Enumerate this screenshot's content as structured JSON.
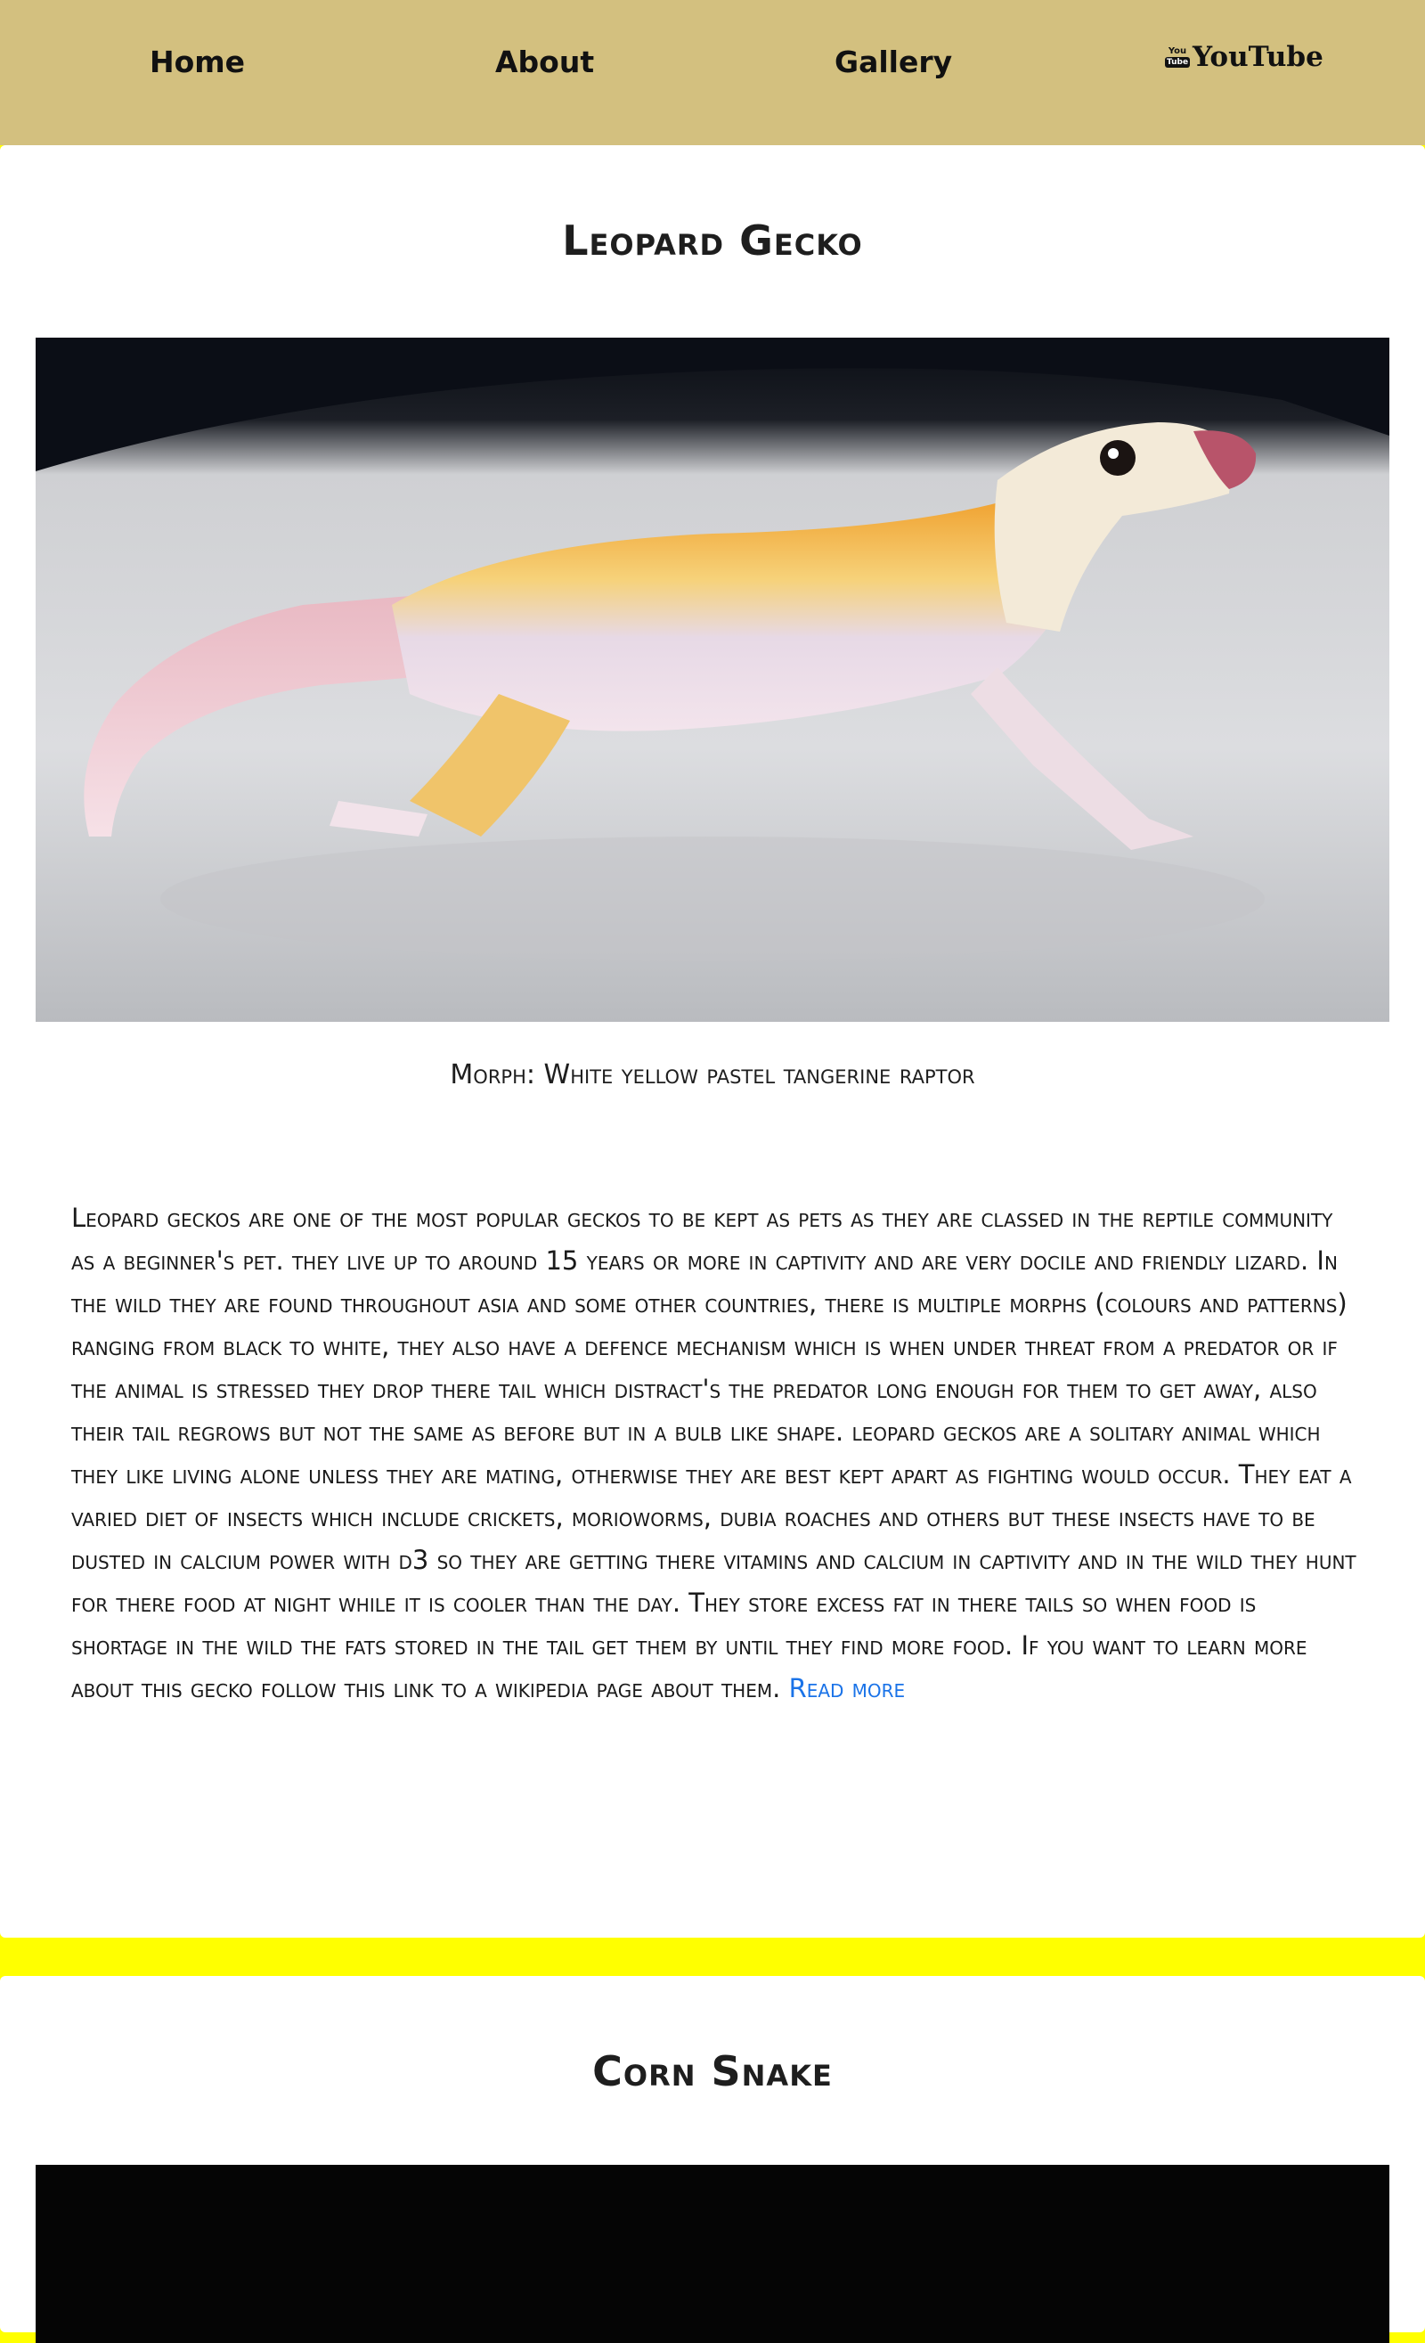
{
  "nav": {
    "home": "Home",
    "about": "About",
    "gallery": "Gallery",
    "youtube": "YouTube",
    "youtube_icon_you": "You",
    "youtube_icon_tube": "Tube"
  },
  "sections": [
    {
      "title": "Leopard Gecko",
      "caption": "Morph: White yellow pastel tangerine raptor",
      "description": "Leopard geckos are one of the most popular geckos to be kept as pets as they are classed in the reptile community as a beginner's pet. they live up to around 15 years or more in captivity and are very docile and friendly lizard. In the wild they are found throughout asia and some other countries, there is multiple morphs (colours and patterns) ranging from black to white, they also have a defence mechanism which is when under threat from a predator or if the animal is stressed they drop there tail which distract's the predator long enough for them to get away, also their tail regrows but not the same as before but in a bulb like shape. leopard geckos are a solitary animal which they like living alone unless they are mating, otherwise they are best kept apart as fighting would occur. They eat a varied diet of insects which include crickets, morioworms, dubia roaches and others but these insects have to be dusted in calcium power with d3 so they are getting there vitamins and calcium in captivity and in the wild they hunt for there food at night while it is cooler than the day. They store excess fat in there tails so when food is shortage in the wild the fats stored in the tail get them by until they find more food. If you want to learn more about this gecko follow this link to a wikipedia page about them.",
      "read_more": "Read more"
    },
    {
      "title": "Corn Snake"
    }
  ],
  "colors": {
    "navbar": "#d3c07f",
    "separator": "#ffff00",
    "link": "#1a73e8"
  }
}
